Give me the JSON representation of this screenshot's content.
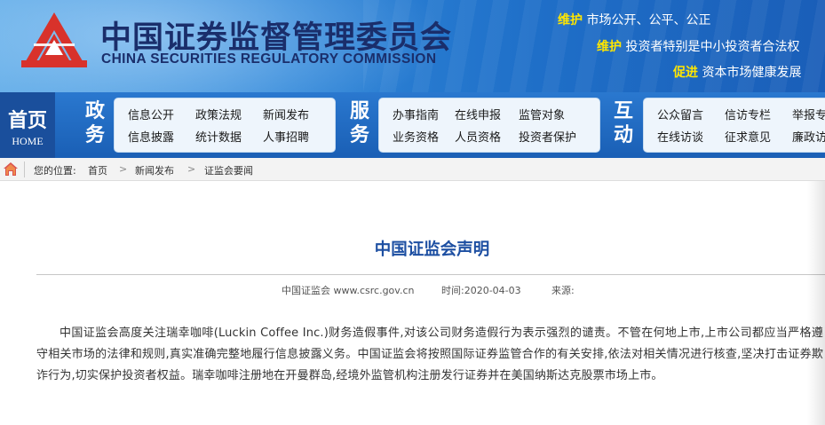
{
  "header": {
    "title_cn": "中国证券监督管理委员会",
    "title_en": "CHINA SECURITIES REGULATORY COMMISSION",
    "slogans": [
      {
        "verb": "维护",
        "rest": "市场公开、公平、公正"
      },
      {
        "verb": "维护",
        "rest": "投资者特别是中小投资者合法权"
      },
      {
        "verb": "促进",
        "rest": "资本市场健康发展"
      }
    ]
  },
  "nav": {
    "home": {
      "cn": "首页",
      "en": "HOME"
    },
    "sections": [
      {
        "label": "政务",
        "links": [
          "信息公开",
          "政策法规",
          "新闻发布",
          "信息披露",
          "统计数据",
          "人事招聘"
        ]
      },
      {
        "label": "服务",
        "links": [
          "办事指南",
          "在线申报",
          "监管对象",
          "业务资格",
          "人员资格",
          "投资者保护"
        ]
      },
      {
        "label": "互动",
        "links": [
          "公众留言",
          "信访专栏",
          "举报专",
          "在线访谈",
          "征求意见",
          "廉政访"
        ]
      }
    ]
  },
  "breadcrumb": {
    "prefix": "您的位置:",
    "items": [
      "首页",
      "新闻发布",
      "证监会要闻"
    ],
    "separator": ">"
  },
  "article": {
    "title": "中国证监会声明",
    "source": "中国证监会 www.csrc.gov.cn",
    "time": "时间:2020-04-03",
    "origin": "来源:",
    "body": "中国证监会高度关注瑞幸咖啡(Luckin Coffee Inc.)财务造假事件,对该公司财务造假行为表示强烈的谴责。不管在何地上市,上市公司都应当严格遵守相关市场的法律和规则,真实准确完整地履行信息披露义务。中国证监会将按照国际证券监管合作的有关安排,依法对相关情况进行核查,坚决打击证券欺诈行为,切实保护投资者权益。瑞幸咖啡注册地在开曼群岛,经境外监管机构注册发行证券并在美国纳斯达克股票市场上市。"
  },
  "colors": {
    "logo_red": "#d8322b",
    "title_navy": "#1a2e6b",
    "slogan_yellow": "#ffe600",
    "article_title_blue": "#1d4fa2"
  },
  "icons": {
    "logo": "csrc-logo",
    "breadcrumb_home": "home-icon"
  }
}
